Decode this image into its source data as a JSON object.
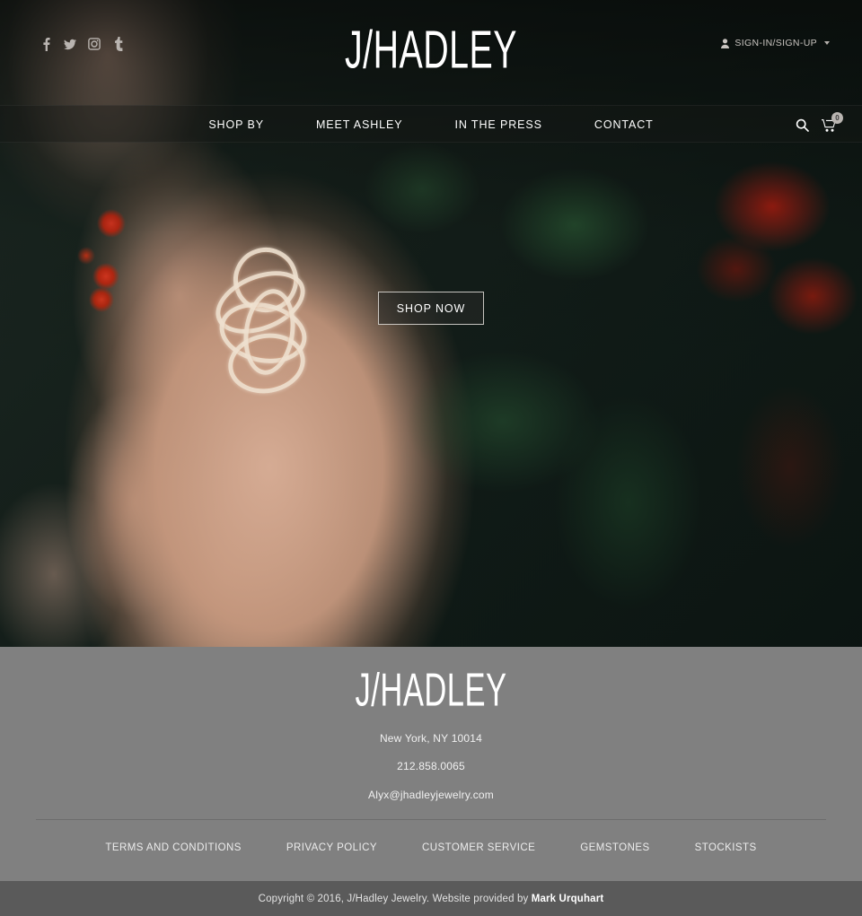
{
  "brand": {
    "logo_prefix": "J",
    "logo_slash": "/",
    "logo_main": "HADLEY"
  },
  "header": {
    "social": [
      {
        "name": "facebook-icon",
        "label": "f",
        "title": "Facebook"
      },
      {
        "name": "twitter-icon",
        "label": "t",
        "title": "Twitter"
      },
      {
        "name": "instagram-icon",
        "label": "i",
        "title": "Instagram"
      },
      {
        "name": "tumblr-icon",
        "label": "t",
        "title": "Tumblr"
      }
    ],
    "account_label": "SIGN-IN/SIGN-UP",
    "account_icon": "user-icon",
    "account_caret": "chevron-down-icon"
  },
  "nav": {
    "items": [
      {
        "label": "SHOP BY"
      },
      {
        "label": "MEET ASHLEY"
      },
      {
        "label": "IN THE PRESS"
      },
      {
        "label": "CONTACT"
      }
    ],
    "search_icon": "search-icon",
    "cart_icon": "cart-icon",
    "cart_count": "0"
  },
  "hero": {
    "cta_label": "SHOP NOW",
    "image_description": "close-up of a hand wearing an ornate rose-gold baguette-diamond swirl ring, red berries and green foliage background"
  },
  "footer": {
    "address": "New York, NY 10014",
    "phone": "212.858.0065",
    "email": "Alyx@jhadleyjewelry.com",
    "links": [
      {
        "label": "TERMS AND CONDITIONS"
      },
      {
        "label": "PRIVACY POLICY"
      },
      {
        "label": "CUSTOMER SERVICE"
      },
      {
        "label": "GEMSTONES"
      },
      {
        "label": "STOCKISTS"
      }
    ]
  },
  "copyright": {
    "text": "Copyright © 2016, J/Hadley Jewelry. Website provided by ",
    "credit": "Mark Urquhart"
  },
  "colors": {
    "footer_bg": "#808080",
    "copybar_bg": "#5a5a5a",
    "text_light": "#ffffff",
    "nav_overlay": "rgba(22,24,22,0.42)"
  }
}
